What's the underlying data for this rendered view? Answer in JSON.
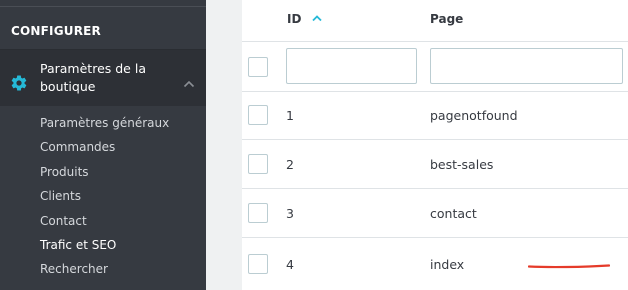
{
  "sidebar": {
    "section_title": "CONFIGURER",
    "active_item": {
      "label": "Paramètres de la boutique",
      "icon": "gear-icon"
    },
    "sub_items": [
      "Paramètres généraux",
      "Commandes",
      "Produits",
      "Clients",
      "Contact",
      "Trafic et SEO",
      "Rechercher"
    ],
    "current_sub_item": "Trafic et SEO",
    "accent_color": "#25b9d7"
  },
  "table": {
    "columns": [
      "ID",
      "Page"
    ],
    "sort_column": "ID",
    "sort_direction": "ascending",
    "filter_id_value": "",
    "filter_page_value": "",
    "rows": [
      {
        "id": "1",
        "page": "pagenotfound"
      },
      {
        "id": "2",
        "page": "best-sales"
      },
      {
        "id": "3",
        "page": "contact"
      },
      {
        "id": "4",
        "page": "index"
      }
    ]
  },
  "annotation_color": "#e53b2a"
}
